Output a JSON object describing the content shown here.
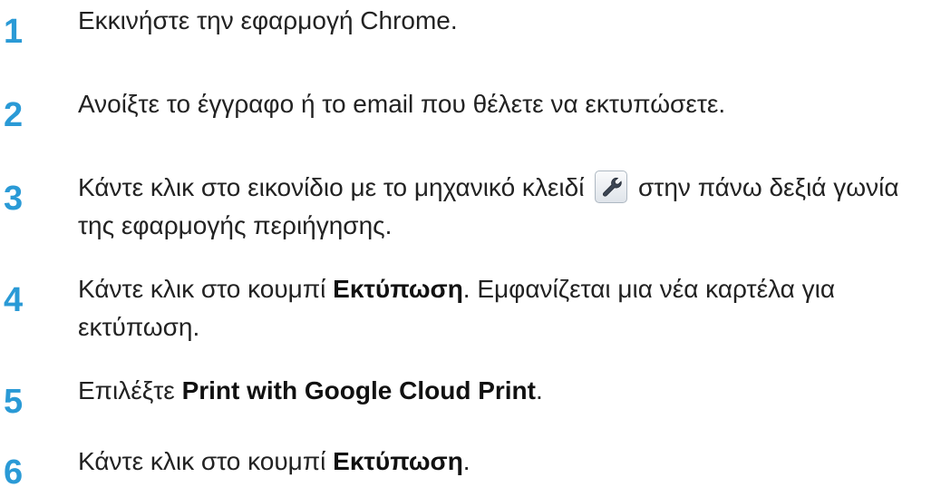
{
  "steps": [
    {
      "number": "1",
      "text": "Εκκινήστε την εφαρμογή Chrome."
    },
    {
      "number": "2",
      "text": "Ανοίξτε το έγγραφο ή το email που θέλετε να εκτυπώσετε."
    },
    {
      "number": "3",
      "text_before": "Κάντε κλικ στο εικονίδιο με το μηχανικό κλειδί",
      "icon": "wrench-icon",
      "text_after": "στην πάνω δεξιά γωνία της εφαρμογής περιήγησης."
    },
    {
      "number": "4",
      "text_before": "Κάντε κλικ στο κουμπί ",
      "bold": "Εκτύπωση",
      "text_after": ". Εμφανίζεται μια νέα καρτέλα για εκτύπωση."
    },
    {
      "number": "5",
      "text_before": "Επιλέξτε ",
      "bold": "Print with Google Cloud Print",
      "text_after": "."
    },
    {
      "number": "6",
      "text_before": "Κάντε κλικ στο κουμπί ",
      "bold": "Εκτύπωση",
      "text_after": "."
    }
  ]
}
